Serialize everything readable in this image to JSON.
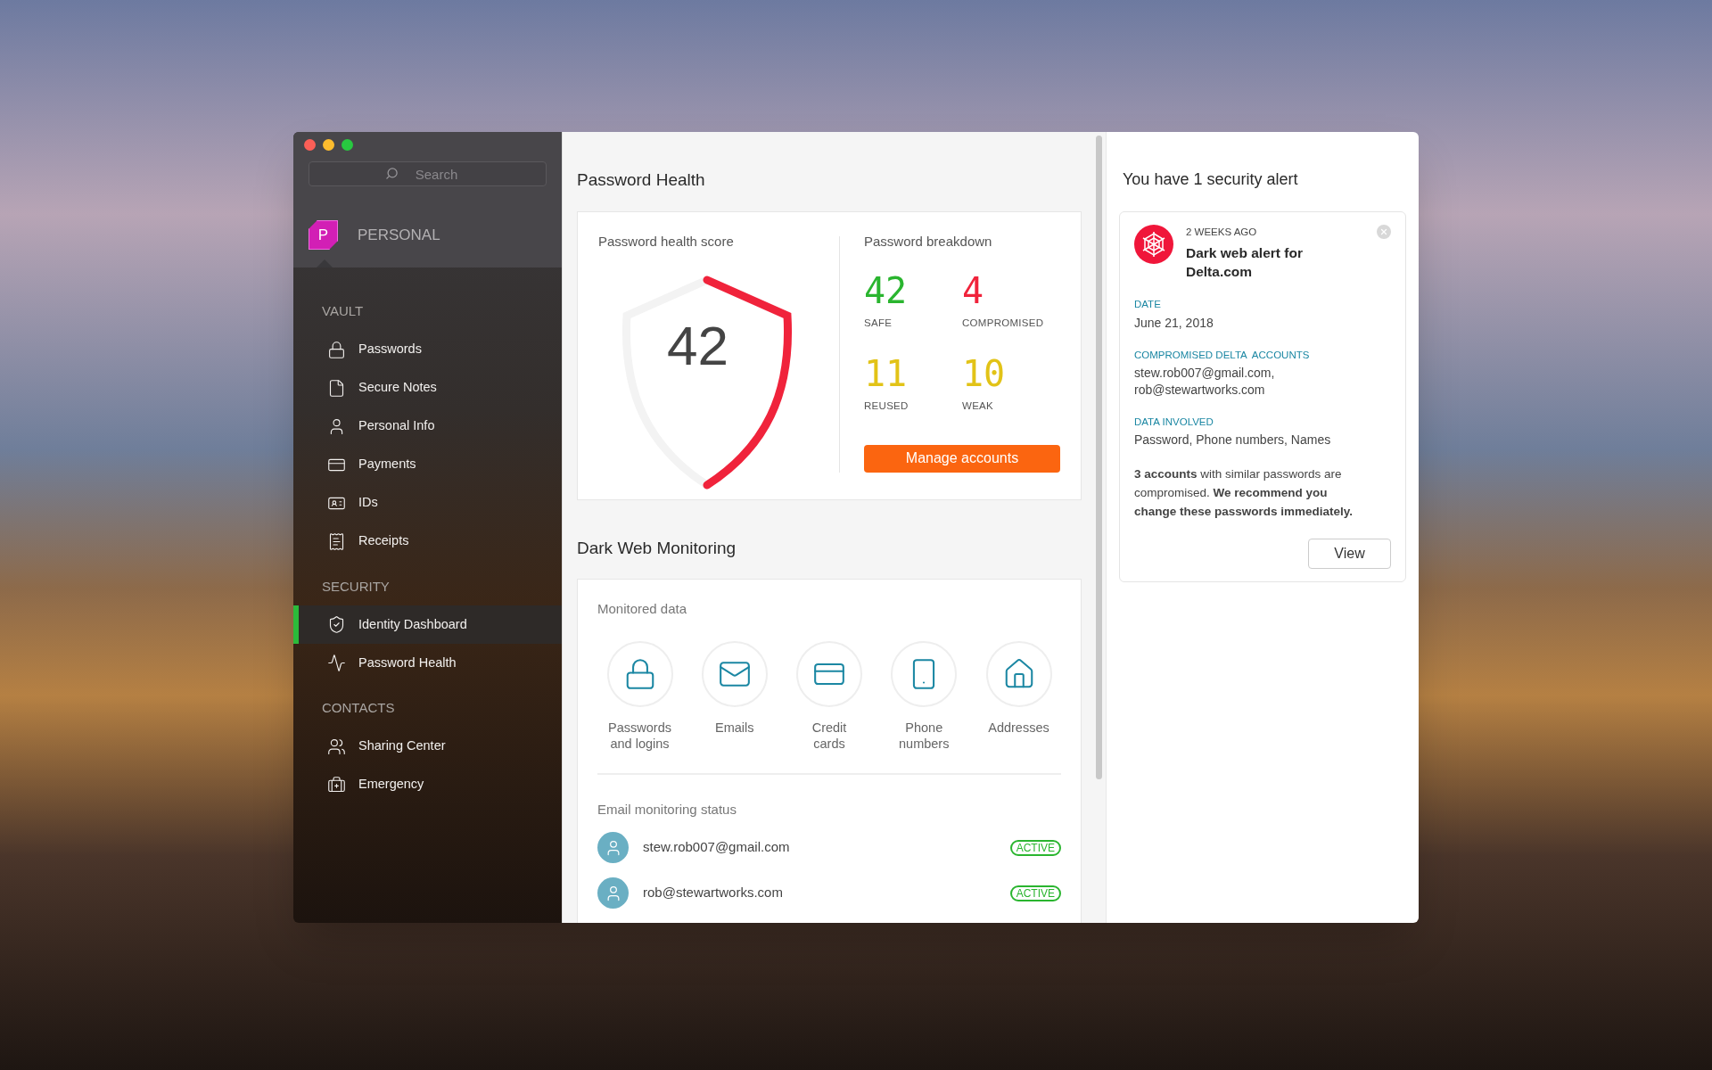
{
  "sidebar": {
    "search": {
      "placeholder": "Search"
    },
    "space": {
      "badge": "P",
      "name": "PERSONAL"
    },
    "sections": [
      {
        "title": "VAULT",
        "items": [
          {
            "label": "Passwords",
            "selected": false
          },
          {
            "label": "Secure Notes",
            "selected": false
          },
          {
            "label": "Personal Info",
            "selected": false
          },
          {
            "label": "Payments",
            "selected": false
          },
          {
            "label": "IDs",
            "selected": false
          },
          {
            "label": "Receipts",
            "selected": false
          }
        ]
      },
      {
        "title": "SECURITY",
        "items": [
          {
            "label": "Identity Dashboard",
            "selected": true
          },
          {
            "label": "Password Health",
            "selected": false
          }
        ]
      },
      {
        "title": "CONTACTS",
        "items": [
          {
            "label": "Sharing Center",
            "selected": false
          },
          {
            "label": "Emergency",
            "selected": false
          }
        ]
      }
    ]
  },
  "password_health": {
    "title": "Password Health",
    "score_title": "Password health score",
    "score": "42",
    "breakdown_title": "Password breakdown",
    "breakdown": [
      {
        "value": "42",
        "label": "SAFE",
        "color": "#2ab52f"
      },
      {
        "value": "4",
        "label": "COMPROMISED",
        "color": "#f0233b"
      },
      {
        "value": "11",
        "label": "REUSED",
        "color": "#e2c317"
      },
      {
        "value": "10",
        "label": "WEAK",
        "color": "#e2c317"
      }
    ],
    "button": "Manage accounts"
  },
  "dark_web_monitoring": {
    "title": "Dark Web Monitoring",
    "monitored_title": "Monitored data",
    "monitored": [
      {
        "label": "Passwords and logins"
      },
      {
        "label": "Emails"
      },
      {
        "label": "Credit cards"
      },
      {
        "label": "Phone numbers"
      },
      {
        "label": "Addresses"
      }
    ],
    "status_title": "Email monitoring status",
    "emails": [
      {
        "email": "stew.rob007@gmail.com",
        "status": "ACTIVE"
      },
      {
        "email": "rob@stewartworks.com",
        "status": "ACTIVE"
      }
    ]
  },
  "alerts": {
    "title": "You have 1 security alert",
    "alert": {
      "time": "2 WEEKS AGO",
      "title": "Dark web alert for Delta.com",
      "fields": [
        {
          "label": "DATE",
          "value": "June 21, 2018"
        },
        {
          "label": "COMPROMISED DELTA  ACCOUNTS",
          "value": "stew.rob007@gmail.com, rob@stewartworks.com"
        },
        {
          "label": "DATA INVOLVED",
          "value": "Password, Phone numbers, Names"
        }
      ],
      "message": "**3 accounts** with similar passwords are compromised. **We recommend you change these passwords immediately.**",
      "button": "View"
    }
  }
}
